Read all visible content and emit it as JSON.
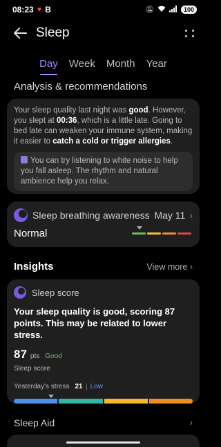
{
  "status_bar": {
    "time": "08:23",
    "indicator": "B",
    "battery": "100",
    "icons": [
      "heart-icon",
      "mute-icon",
      "wifi-icon",
      "signal-icon"
    ]
  },
  "app_bar": {
    "title": "Sleep"
  },
  "tabs": [
    {
      "label": "Day",
      "active": true
    },
    {
      "label": "Week",
      "active": false
    },
    {
      "label": "Month",
      "active": false
    },
    {
      "label": "Year",
      "active": false
    }
  ],
  "analysis": {
    "title": "Analysis & recommendations",
    "p1": "Your sleep quality last night was ",
    "quality": "good",
    "p2": ". However, you slept at ",
    "time": "00:36",
    "p3": ", which is a little late. Going to bed late can weaken your immune system, making it easier to ",
    "risk": "catch a cold or trigger allergies",
    "p4": ".",
    "tip": "You can try listening to white noise to help you fall asleep. The rhythm and natural ambience help you relax."
  },
  "breathing": {
    "title": "Sleep breathing awareness",
    "date": "May 11",
    "status": "Normal",
    "scale_colors": [
      "#6bbf4f",
      "#f0c23a",
      "#f08a3a",
      "#e0473a"
    ]
  },
  "insights": {
    "title": "Insights",
    "view_more": "View more"
  },
  "sleep_score": {
    "label": "Sleep score",
    "description": "Your sleep quality is good, scoring 87 points. This may be related to lower stress.",
    "value": "87",
    "unit": "pts",
    "grade": "Good",
    "caption": "Sleep score",
    "stress_label": "Yesterday's stress",
    "stress_value": "21",
    "stress_level": "Low",
    "stress_fraction": 0.21,
    "stress_colors": [
      "#4f8ee8",
      "#33b5a5",
      "#f2b92c",
      "#f08a22"
    ]
  },
  "sleep_aid": {
    "label": "Sleep Aid"
  }
}
